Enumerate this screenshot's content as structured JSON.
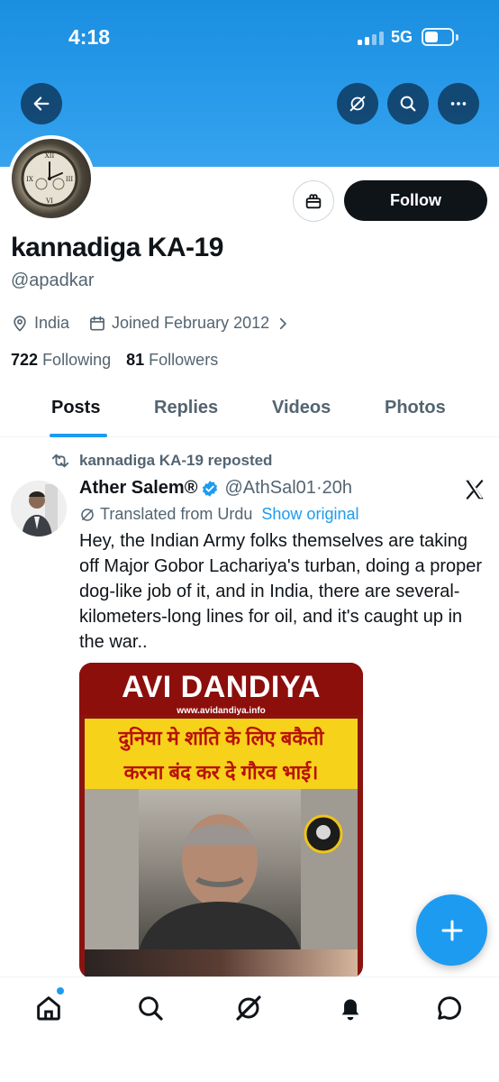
{
  "status_bar": {
    "time": "4:18",
    "network": "5G"
  },
  "header": {
    "back_icon": "arrow-left-icon",
    "grok_icon": "grok-icon",
    "search_icon": "search-icon",
    "more_icon": "more-icon"
  },
  "profile": {
    "display_name": "kannadiga KA-19",
    "handle": "@apadkar",
    "location": "India",
    "joined": "Joined February 2012",
    "following_count": "722",
    "following_label": "Following",
    "followers_count": "81",
    "followers_label": "Followers",
    "follow_label": "Follow"
  },
  "tabs": [
    {
      "label": "Posts",
      "active": true
    },
    {
      "label": "Replies",
      "active": false
    },
    {
      "label": "Videos",
      "active": false
    },
    {
      "label": "Photos",
      "active": false
    }
  ],
  "post": {
    "repost_text": "kannadiga KA-19 reposted",
    "author_name": "Ather Salem®",
    "author_handle": "@AthSal01",
    "time": "·20h",
    "translated_label": "Translated from Urdu",
    "show_original": "Show original",
    "text": "Hey, the Indian Army folks themselves are taking off Major Gobor Lachariya's turban, doing a proper dog-like job of it, and in India, there are several-kilometers-long lines for oil, and it's caught up in the war..",
    "media": {
      "brand": "AVI DANDIYA",
      "site": "www.avidandiya.info",
      "hindi_line1": "दुनिया मे शांति के लिए बकैती",
      "hindi_line2": "करना बंद कर दे गौरव भाई।"
    }
  },
  "colors": {
    "accent": "#1d9bf0",
    "banner": "#2a9bea",
    "text": "#0f1419",
    "muted": "#536471"
  }
}
